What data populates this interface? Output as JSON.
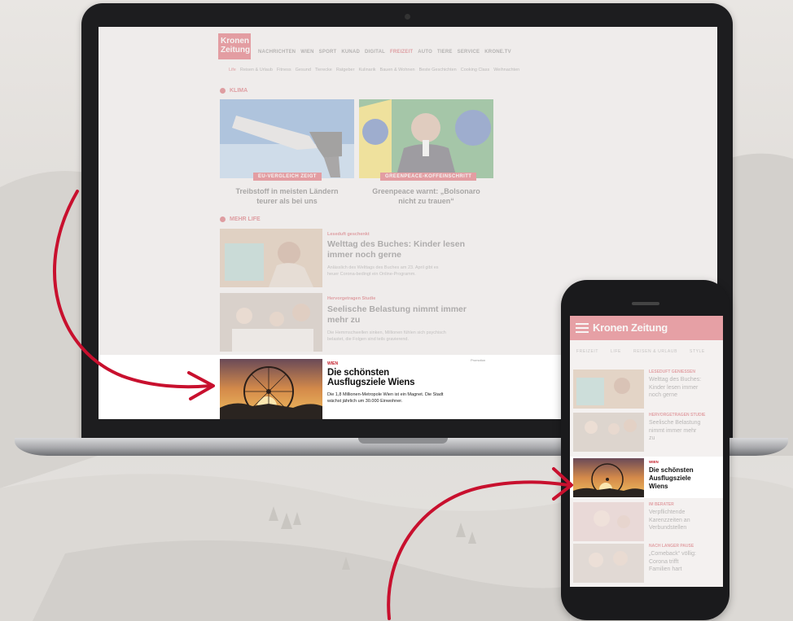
{
  "desktop": {
    "logo_line1": "Kronen",
    "logo_line2": "Zeitung",
    "nav": [
      "NACHRICHTEN",
      "WIEN",
      "SPORT",
      "KUNAD",
      "DIGITAL",
      "FREIZEIT",
      "AUTO",
      "TIERE",
      "SERVICE",
      "KRONE.TV"
    ],
    "subnav": [
      "Life",
      "Reisen & Urlaub",
      "Fitness",
      "Gesund",
      "Tierecke",
      "Ratgeber",
      "Kulinarik",
      "Bauen & Wohnen",
      "Beste Geschichten",
      "Cooking Class",
      "Weihnachten"
    ],
    "section_klima": "KLIMA",
    "cards": [
      {
        "badge": "EU-VERGLEICH ZEIGT",
        "title_line1": "Treibstoff in meisten Ländern",
        "title_line2": "teurer als bei uns"
      },
      {
        "badge": "GREENPEACE-KOFFEINSCHRITT",
        "title_line1": "Greenpeace warnt: „Bolsonaro",
        "title_line2": "nicht zu trauen“"
      }
    ],
    "section_life": "MEHR LIFE",
    "list": [
      {
        "kicker": "Leseduft geschenkt",
        "title_line1": "Welttag des Buches: Kinder lesen",
        "title_line2": "immer noch gerne",
        "teaser_line1": "Anlässlich des Welttags des Buches am 23. April gibt es",
        "teaser_line2": "heuer Corona-bedingt ein Online-Programm."
      },
      {
        "kicker": "Hervorgetragen Studie",
        "title_line1": "Seelische Belastung nimmt immer",
        "title_line2": "mehr zu",
        "teaser_line1": "Die Hemmschwellen sinken, Millionen fühlen sich psychisch",
        "teaser_line2": "belastet, die Folgen sind teils gravierend."
      }
    ],
    "highlight": {
      "kicker": "WIEN",
      "title_line1": "Die schönsten",
      "title_line2": "Ausflugsziele Wiens",
      "teaser_line1": "Die 1,8 Millionen-Metropole Wien ist ein Magnet. Die Stadt",
      "teaser_line2": "wächst jährlich um 30.000 Einwohner.",
      "ad_label": "Promotion"
    }
  },
  "phone": {
    "logo": "Kronen Zeitung",
    "tabs": [
      "FREIZEIT",
      "LIFE",
      "REISEN & URLAUB",
      "STYLE"
    ],
    "rows": [
      {
        "kicker": "LESEDUFT GENIESSEN",
        "title_line1": "Welttag des Buches:",
        "title_line2": "Kinder lesen immer",
        "title_line3": "noch gerne"
      },
      {
        "kicker": "HERVORGETRAGEN STUDIE",
        "title_line1": "Seelische Belastung",
        "title_line2": "nimmt immer mehr",
        "title_line3": "zu"
      },
      {
        "kicker": "IM BERATER",
        "title_line1": "Verpflichtende",
        "title_line2": "Karenzzeiten an",
        "title_line3": "Verbundstellen"
      },
      {
        "kicker": "NACH LANGER PAUSE",
        "title_line1": "„Comeback“ völlig:",
        "title_line2": "Corona trifft",
        "title_line3": "Familien hart"
      }
    ],
    "highlight": {
      "kicker": "WIEN",
      "title_line1": "Die schönsten",
      "title_line2": "Ausflugsziele",
      "title_line3": "Wiens"
    }
  },
  "colors": {
    "brand_red": "#d0202e",
    "arrow_red": "#c8102e",
    "device_black": "#1d1d1f"
  }
}
